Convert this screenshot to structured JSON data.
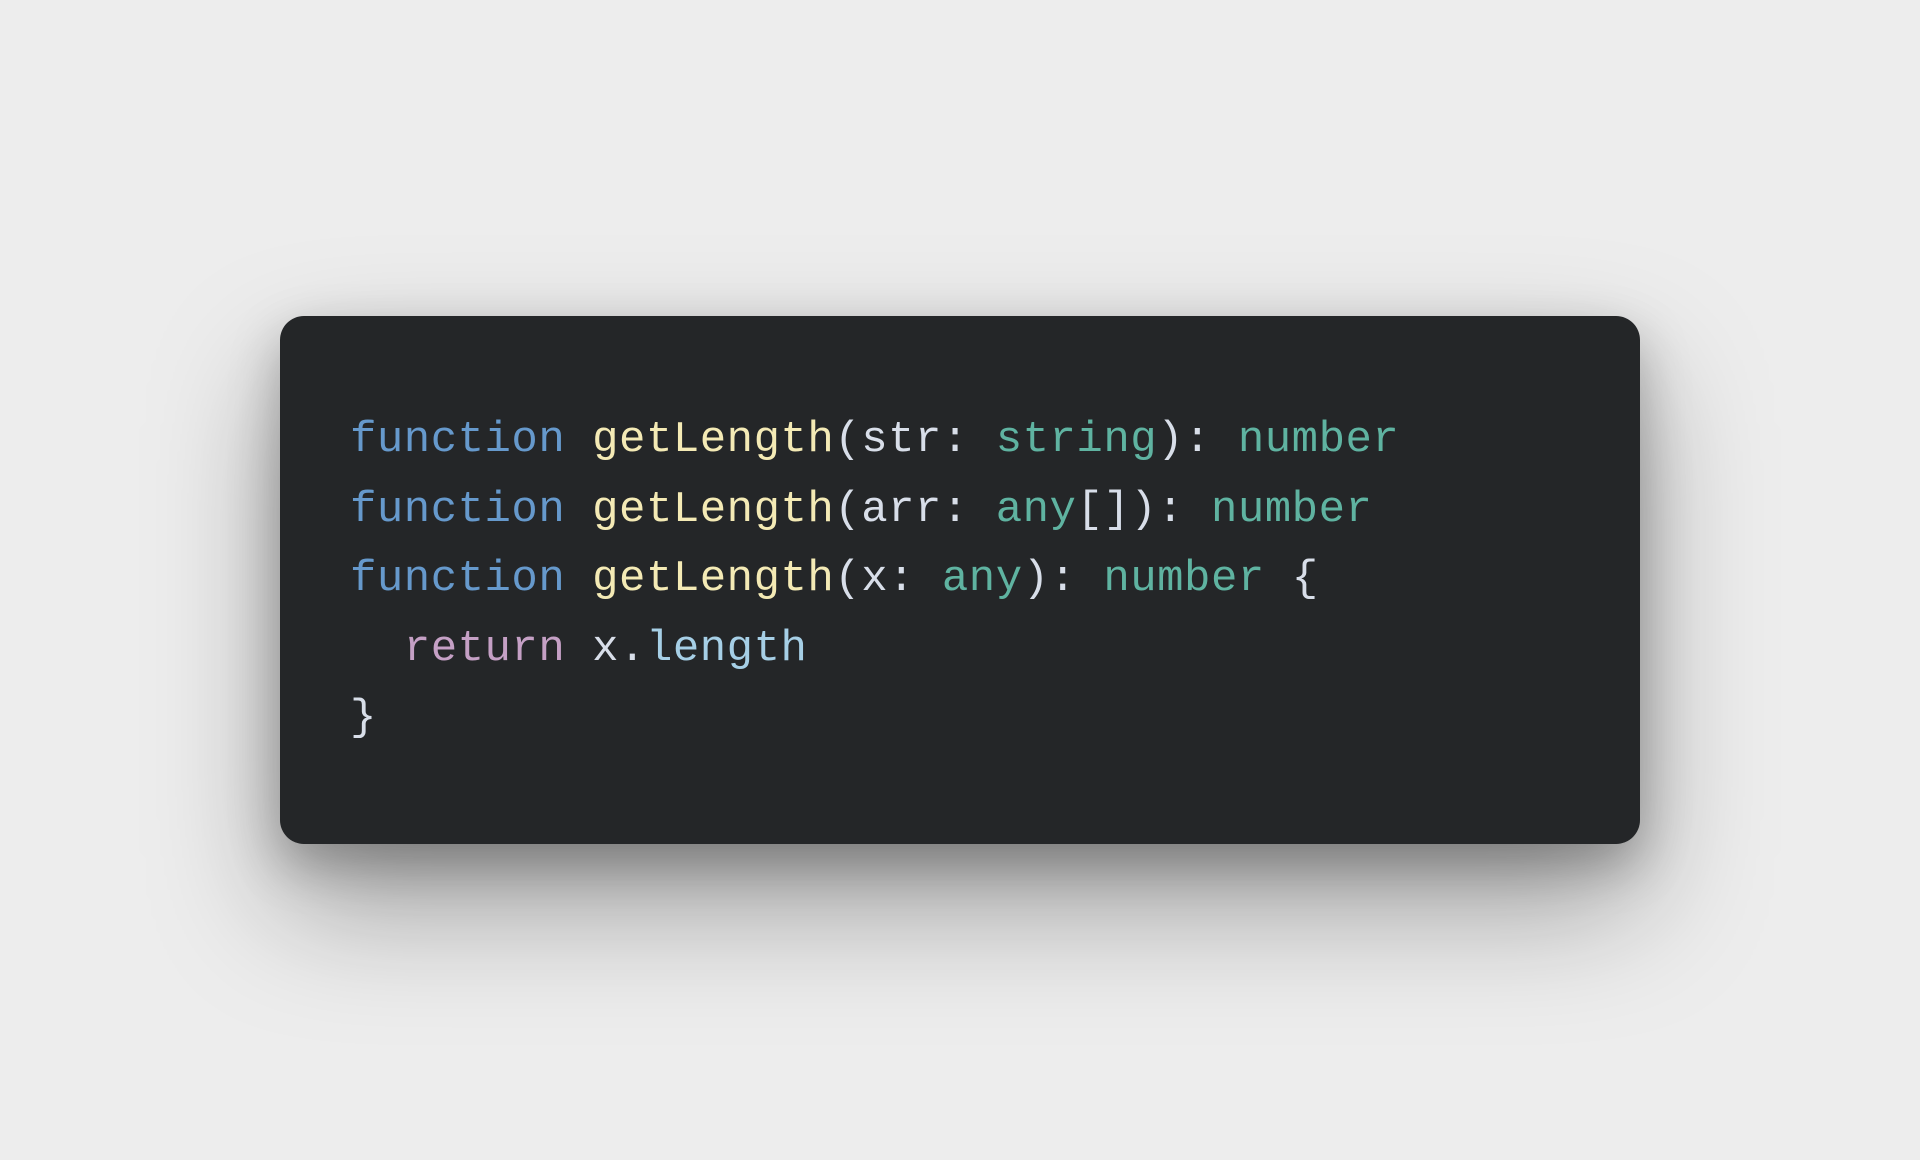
{
  "code": {
    "line1": {
      "keyword": "function",
      "funcName": "getLength",
      "openParen": "(",
      "param": "str",
      "paramColon": ": ",
      "paramType": "string",
      "closeParen": ")",
      "returnColon": ": ",
      "returnType": "number"
    },
    "line2": {
      "keyword": "function",
      "funcName": "getLength",
      "openParen": "(",
      "param": "arr",
      "paramColon": ": ",
      "paramType": "any",
      "arrayBrackets": "[]",
      "closeParen": ")",
      "returnColon": ": ",
      "returnType": "number"
    },
    "line3": {
      "keyword": "function",
      "funcName": "getLength",
      "openParen": "(",
      "param": "x",
      "paramColon": ": ",
      "paramType": "any",
      "closeParen": ")",
      "returnColon": ": ",
      "returnType": "number",
      "space": " ",
      "openBrace": "{"
    },
    "line4": {
      "indent": "  ",
      "keyword": "return",
      "space": " ",
      "identifier": "x",
      "dot": ".",
      "property": "length"
    },
    "line5": {
      "closeBrace": "}"
    }
  }
}
